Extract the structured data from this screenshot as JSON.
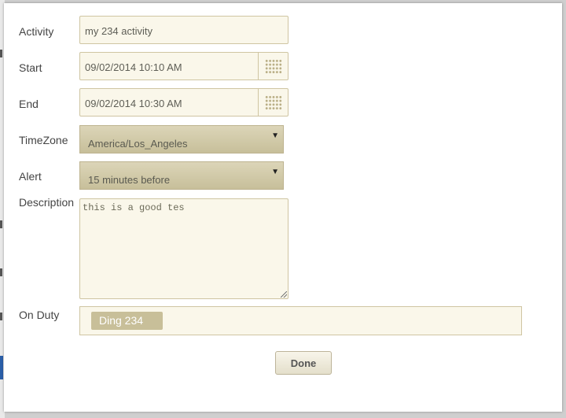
{
  "form": {
    "activity": {
      "label": "Activity",
      "value": "my 234 activity"
    },
    "start": {
      "label": "Start",
      "value": "09/02/2014 10:10 AM",
      "picker_icon": "calendar-grid-icon"
    },
    "end": {
      "label": "End",
      "value": "09/02/2014 10:30 AM",
      "picker_icon": "calendar-grid-icon"
    },
    "timezone": {
      "label": "TimeZone",
      "selected": "America/Los_Angeles",
      "arrow": "▼"
    },
    "alert": {
      "label": "Alert",
      "selected": "15 minutes before",
      "arrow": "▼"
    },
    "description": {
      "label": "Description",
      "value": "this is a good tes"
    },
    "on_duty": {
      "label": "On Duty",
      "tags": [
        "Ding 234"
      ]
    }
  },
  "actions": {
    "done_label": "Done"
  },
  "colors": {
    "field_bg": "#faf7ea",
    "field_border": "#cfc5a2",
    "select_bg": "#d3cbab",
    "tag_bg": "#c8bf99"
  }
}
